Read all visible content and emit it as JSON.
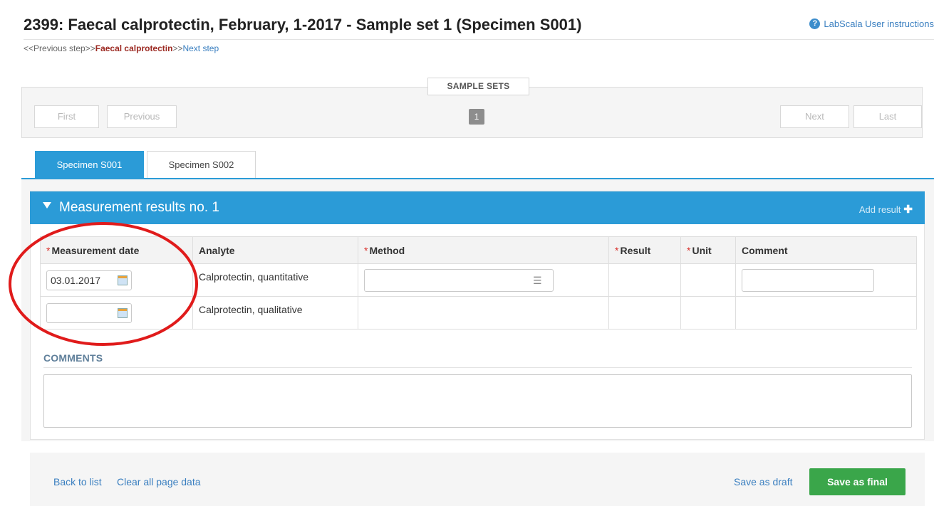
{
  "header": {
    "title": "2399: Faecal calprotectin, February, 1-2017 - Sample set 1 (Specimen S001)",
    "help_link": "LabScala User instructions"
  },
  "breadcrumb": {
    "prev": "<<Previous step>>",
    "current": "Faecal calprotectin",
    "sep": ">>",
    "next": "Next step"
  },
  "pager": {
    "label": "SAMPLE SETS",
    "first": "First",
    "previous": "Previous",
    "page": "1",
    "next": "Next",
    "last": "Last"
  },
  "tabs": [
    {
      "label": "Specimen S001",
      "active": true
    },
    {
      "label": "Specimen S002",
      "active": false
    }
  ],
  "results": {
    "title": "Measurement results no. 1",
    "add_result": "Add result",
    "columns": {
      "date": "Measurement date",
      "analyte": "Analyte",
      "method": "Method",
      "result": "Result",
      "unit": "Unit",
      "comment": "Comment"
    },
    "rows": [
      {
        "date": "03.01.2017",
        "analyte": "Calprotectin, quantitative"
      },
      {
        "date": "",
        "analyte": "Calprotectin, qualitative"
      }
    ]
  },
  "comments": {
    "label": "COMMENTS"
  },
  "footer": {
    "back": "Back to list",
    "clear": "Clear all page data",
    "draft": "Save as draft",
    "final": "Save as final"
  },
  "colors": {
    "accent": "#2b9bd7",
    "save_final": "#3aa64a",
    "annotation": "#e01b1b"
  }
}
